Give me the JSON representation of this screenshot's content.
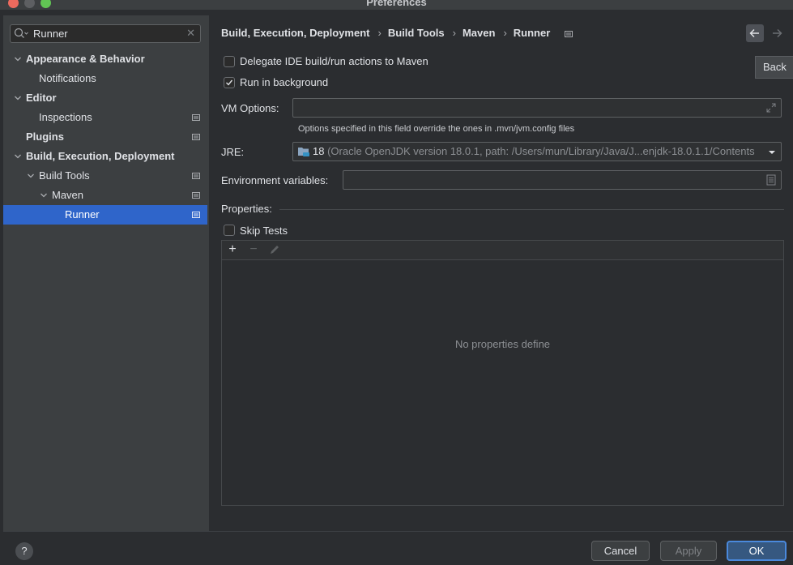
{
  "window": {
    "title": "Preferences"
  },
  "search": {
    "value": "Runner"
  },
  "tree": [
    {
      "label": "Appearance & Behavior",
      "bold": true,
      "expanded": true,
      "level": 0,
      "modified": false
    },
    {
      "label": "Notifications",
      "bold": false,
      "level": 1,
      "modified": false
    },
    {
      "label": "Editor",
      "bold": true,
      "expanded": true,
      "level": 0,
      "modified": false
    },
    {
      "label": "Inspections",
      "bold": false,
      "level": 1,
      "modified": true
    },
    {
      "label": "Plugins",
      "bold": true,
      "level": 0,
      "modified": true
    },
    {
      "label": "Build, Execution, Deployment",
      "bold": true,
      "expanded": true,
      "level": 0,
      "modified": false
    },
    {
      "label": "Build Tools",
      "bold": false,
      "expanded": true,
      "level": 1,
      "modified": true
    },
    {
      "label": "Maven",
      "bold": false,
      "expanded": true,
      "level": 2,
      "modified": true
    },
    {
      "label": "Runner",
      "bold": false,
      "level": 3,
      "modified": true,
      "selected": true
    }
  ],
  "breadcrumb": [
    "Build, Execution, Deployment",
    "Build Tools",
    "Maven",
    "Runner"
  ],
  "tooltip": {
    "text": "Back"
  },
  "options": {
    "delegate_label": "Delegate IDE build/run actions to Maven",
    "delegate_checked": false,
    "background_label": "Run in background",
    "background_checked": true
  },
  "vm_options": {
    "label": "VM Options:",
    "value": "",
    "hint": "Options specified in this field override the ones in .mvn/jvm.config files"
  },
  "jre": {
    "label": "JRE:",
    "version": "18",
    "path": "(Oracle OpenJDK version 18.0.1, path: /Users/mun/Library/Java/J...enjdk-18.0.1.1/Contents"
  },
  "env": {
    "label": "Environment variables:",
    "value": ""
  },
  "properties": {
    "label": "Properties:",
    "skip_tests_label": "Skip Tests",
    "skip_tests_checked": false,
    "empty_text": "No properties define"
  },
  "footer": {
    "help": "?",
    "cancel": "Cancel",
    "apply": "Apply",
    "ok": "OK"
  },
  "colors": {
    "selection": "#2f65ca",
    "primary_button": "#365880",
    "focus_ring": "#4a89dc"
  }
}
